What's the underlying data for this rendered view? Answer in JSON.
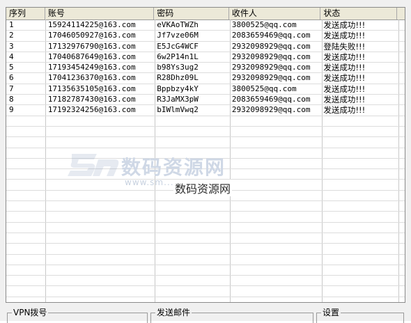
{
  "table": {
    "columns": [
      "序列",
      "账号",
      "密码",
      "收件人",
      "状态"
    ],
    "rows": [
      [
        "1",
        "15924114225@163.com",
        "eVKAoTWZh",
        "3800525@qq.com",
        "发送成功!!!"
      ],
      [
        "2",
        "17046050927@163.com",
        "Jf7vze06M",
        "2083659469@qq.com",
        "发送成功!!!"
      ],
      [
        "3",
        "17132976790@163.com",
        "E5JcG4WCF",
        "2932098929@qq.com",
        "登陆失败!!!"
      ],
      [
        "4",
        "17040687649@163.com",
        "6w2P14n1L",
        "2932098929@qq.com",
        "发送成功!!!"
      ],
      [
        "5",
        "17193454249@163.com",
        "b98Ys3ug2",
        "2932098929@qq.com",
        "发送成功!!!"
      ],
      [
        "6",
        "17041236370@163.com",
        "R28Dhz09L",
        "2932098929@qq.com",
        "发送成功!!!"
      ],
      [
        "7",
        "17135635105@163.com",
        "Bppbzy4kY",
        "3800525@qq.com",
        "发送成功!!!"
      ],
      [
        "8",
        "17182787430@163.com",
        "R3JaMX3pW",
        "2083659469@qq.com",
        "发送成功!!!"
      ],
      [
        "9",
        "17192324256@163.com",
        "bIWlmVwq2",
        "2932098929@qq.com",
        "发送成功!!!"
      ]
    ],
    "empty_rows": 17
  },
  "watermark": {
    "title": "数码资源网",
    "url": "www.sm...",
    "overlay": "数码资源网"
  },
  "groups": {
    "vpn": "VPN拨号",
    "mail": "发送邮件",
    "settings": "设置"
  }
}
